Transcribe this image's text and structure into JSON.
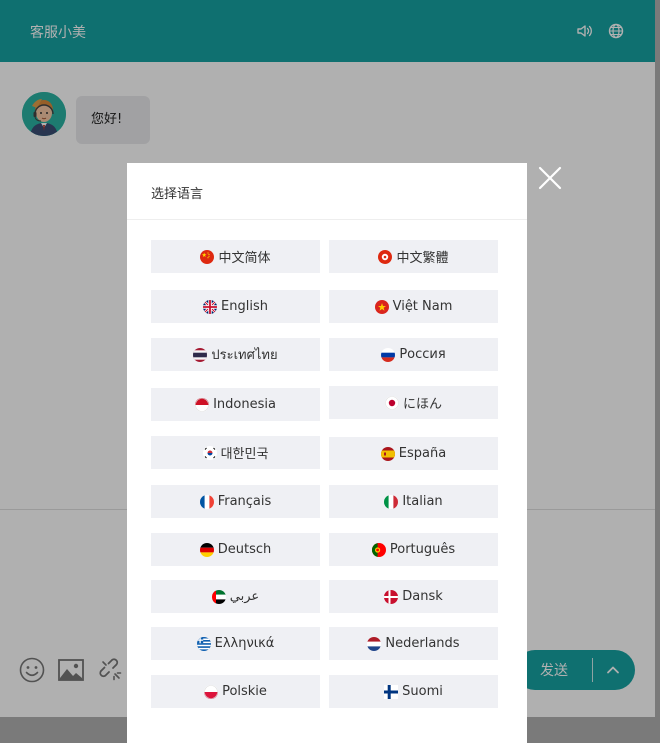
{
  "header": {
    "title": "客服小美"
  },
  "chat": {
    "greeting": "您好!"
  },
  "composer": {
    "send_label": "发送"
  },
  "language_modal": {
    "title": "选择语言",
    "languages": [
      {
        "label": "中文简体",
        "flag": "cn"
      },
      {
        "label": "中文繁體",
        "flag": "hk"
      },
      {
        "label": "English",
        "flag": "uk"
      },
      {
        "label": "Việt Nam",
        "flag": "vn"
      },
      {
        "label": "ประเทศไทย",
        "flag": "th"
      },
      {
        "label": "Россия",
        "flag": "ru"
      },
      {
        "label": "Indonesia",
        "flag": "id"
      },
      {
        "label": "にほん",
        "flag": "jp"
      },
      {
        "label": "대한민국",
        "flag": "kr"
      },
      {
        "label": "España",
        "flag": "es"
      },
      {
        "label": "Français",
        "flag": "fr"
      },
      {
        "label": "Italian",
        "flag": "it"
      },
      {
        "label": "Deutsch",
        "flag": "de"
      },
      {
        "label": "Português",
        "flag": "pt"
      },
      {
        "label": "عربي",
        "flag": "ae"
      },
      {
        "label": "Dansk",
        "flag": "dk"
      },
      {
        "label": "Ελληνικά",
        "flag": "gr"
      },
      {
        "label": "Nederlands",
        "flag": "nl"
      },
      {
        "label": "Polskie",
        "flag": "pl"
      },
      {
        "label": "Suomi",
        "flag": "fi"
      }
    ]
  },
  "colors": {
    "accent": "#17a2a2",
    "overlay": "rgba(0,0,0,0.31)",
    "button_bg": "#eff0f4"
  }
}
